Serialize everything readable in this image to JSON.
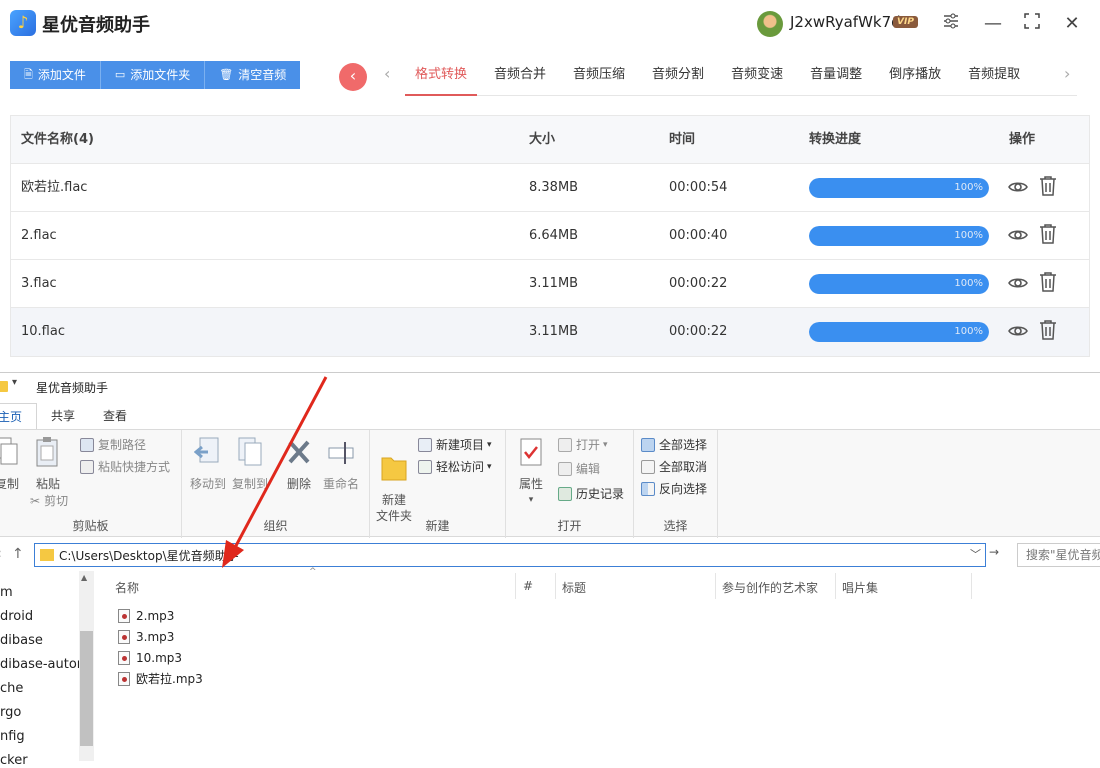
{
  "app": {
    "title": "星优音频助手",
    "username": "J2xwRyafWk7d",
    "vip": "VIP",
    "toolbar": [
      {
        "label": "添加文件",
        "icon": "file-icon"
      },
      {
        "label": "添加文件夹",
        "icon": "folder-icon"
      },
      {
        "label": "清空音频",
        "icon": "trash-icon"
      }
    ],
    "tabs": [
      "格式转换",
      "音频合并",
      "音频压缩",
      "音频分割",
      "音频变速",
      "音量调整",
      "倒序播放",
      "音频提取"
    ],
    "active_tab": "格式转换",
    "table": {
      "headers": {
        "name": "文件名称(4)",
        "size": "大小",
        "time": "时间",
        "progress": "转换进度",
        "ops": "操作"
      },
      "rows": [
        {
          "name": "欧若拉.flac",
          "size": "8.38MB",
          "time": "00:00:54",
          "progress": 1.0,
          "progress_label": "100%"
        },
        {
          "name": "2.flac",
          "size": "6.64MB",
          "time": "00:00:40",
          "progress": 1.0,
          "progress_label": "100%"
        },
        {
          "name": "3.flac",
          "size": "3.11MB",
          "time": "00:00:22",
          "progress": 1.0,
          "progress_label": "100%"
        },
        {
          "name": "10.flac",
          "size": "3.11MB",
          "time": "00:00:22",
          "progress": 1.0,
          "progress_label": "100%"
        }
      ]
    },
    "colors": {
      "accent": "#4a90e8",
      "tab_active": "#e05a5a",
      "progress": "#3a8ff0"
    }
  },
  "explorer": {
    "title": "星优音频助手",
    "quick_access_arrow": "▾",
    "ribbon_tabs": [
      "主页",
      "共享",
      "查看"
    ],
    "ribbon": {
      "clipboard": {
        "label": "剪贴板",
        "copy": "复制",
        "paste": "粘贴",
        "copy_path": "复制路径",
        "paste_shortcut": "粘贴快捷方式",
        "cut": "剪切"
      },
      "organize": {
        "label": "组织",
        "move_to": "移动到",
        "copy_to": "复制到",
        "delete": "删除",
        "rename": "重命名"
      },
      "new": {
        "label": "新建",
        "new_folder": "新建\n文件夹",
        "new_item": "新建项目",
        "easy_access": "轻松访问"
      },
      "open": {
        "label": "打开",
        "properties": "属性",
        "open": "打开",
        "edit": "编辑",
        "history": "历史记录"
      },
      "select": {
        "label": "选择",
        "select_all": "全部选择",
        "select_none": "全部取消",
        "invert": "反向选择"
      }
    },
    "address": "C:\\Users\\Desktop\\星优音频助手",
    "search_placeholder": "搜索\"星优音频",
    "nav_items": [
      "m",
      "droid",
      "dibase",
      "dibase-autom",
      "che",
      "rgo",
      "nfig",
      "cker"
    ],
    "columns": [
      "名称",
      "#",
      "标题",
      "参与创作的艺术家",
      "唱片集"
    ],
    "files": [
      "2.mp3",
      "3.mp3",
      "10.mp3",
      "欧若拉.mp3"
    ]
  }
}
